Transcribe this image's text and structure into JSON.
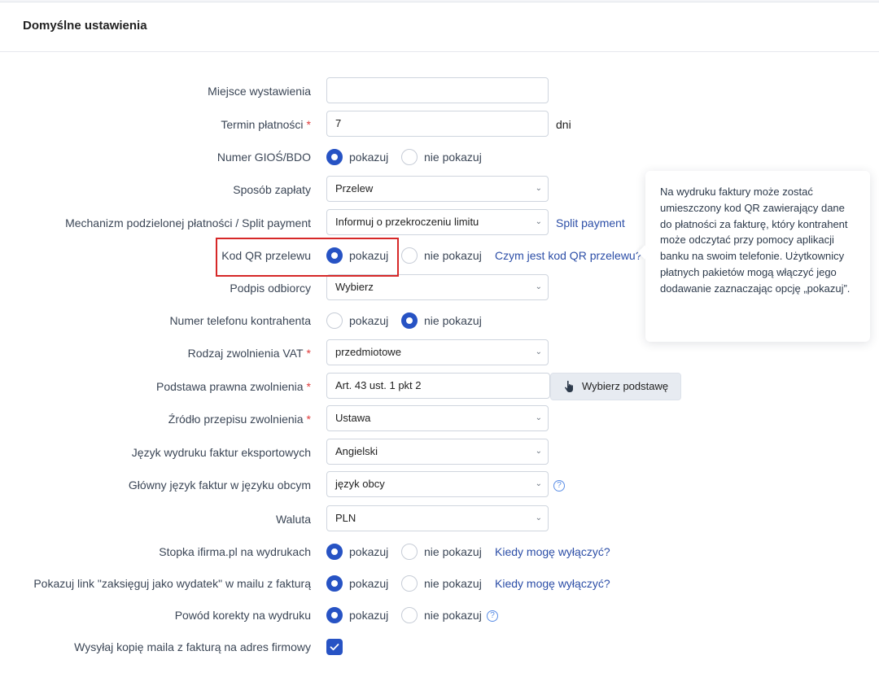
{
  "header": {
    "title": "Domyślne ustawienia"
  },
  "radio": {
    "show": "pokazuj",
    "hide": "nie pokazuj"
  },
  "fields": {
    "place": {
      "label": "Miejsce wystawienia",
      "value": ""
    },
    "payment_term": {
      "label": "Termin płatności",
      "required": "*",
      "value": "7",
      "suffix": "dni"
    },
    "gios": {
      "label": "Numer GIOŚ/BDO",
      "selected": "pokazuj"
    },
    "payment_method": {
      "label": "Sposób zapłaty",
      "value": "Przelew"
    },
    "split": {
      "label": "Mechanizm podzielonej płatności / Split payment",
      "value": "Informuj o przekroczeniu limitu",
      "link": "Split payment"
    },
    "qr": {
      "label": "Kod QR przelewu",
      "selected": "pokazuj",
      "link": "Czym jest kod QR przelewu?"
    },
    "signature": {
      "label": "Podpis odbiorcy",
      "value": "Wybierz"
    },
    "phone": {
      "label": "Numer telefonu kontrahenta",
      "selected": "nie pokazuj"
    },
    "vat_exemption": {
      "label": "Rodzaj zwolnienia VAT",
      "required": "*",
      "value": "przedmiotowe"
    },
    "legal_basis": {
      "label": "Podstawa prawna zwolnienia",
      "required": "*",
      "value": "Art. 43 ust. 1 pkt 2",
      "button": "Wybierz podstawę"
    },
    "regulation_source": {
      "label": "Źródło przepisu zwolnienia",
      "required": "*",
      "value": "Ustawa"
    },
    "export_language": {
      "label": "Język wydruku faktur eksportowych",
      "value": "Angielski"
    },
    "main_language": {
      "label": "Główny język faktur w języku obcym",
      "value": "język obcy",
      "help": "?"
    },
    "currency": {
      "label": "Waluta",
      "value": "PLN"
    },
    "footer": {
      "label": "Stopka ifirma.pl na wydrukach",
      "selected": "pokazuj",
      "link": "Kiedy mogę wyłączyć?"
    },
    "expense_link": {
      "label": "Pokazuj link \"zaksięguj jako wydatek\" w mailu z fakturą",
      "selected": "pokazuj",
      "link": "Kiedy mogę wyłączyć?"
    },
    "correction_reason": {
      "label": "Powód korekty na wydruku",
      "selected": "pokazuj",
      "help": "?"
    },
    "mail_copy": {
      "label": "Wysyłaj kopię maila z fakturą na adres firmowy",
      "checked": true
    }
  },
  "tooltip": {
    "text": "Na wydruku faktury może zostać umieszczony kod QR zawierający dane do płatności za fakturę, który kontrahent może odczytać przy pomocy aplikacji banku na swoim telefonie. Użytkownicy płatnych pakietów mogą włączyć jego dodawanie zaznaczając opcję „pokazuj”."
  },
  "colors": {
    "accent": "#2753c4",
    "link": "#2c4ea7",
    "required": "#e03b3b",
    "highlight": "#d62828"
  },
  "icons": {
    "select": "chevron-down-icon",
    "button": "hand-pointer-icon",
    "help": "question-circle-icon",
    "checkbox": "check-icon"
  }
}
